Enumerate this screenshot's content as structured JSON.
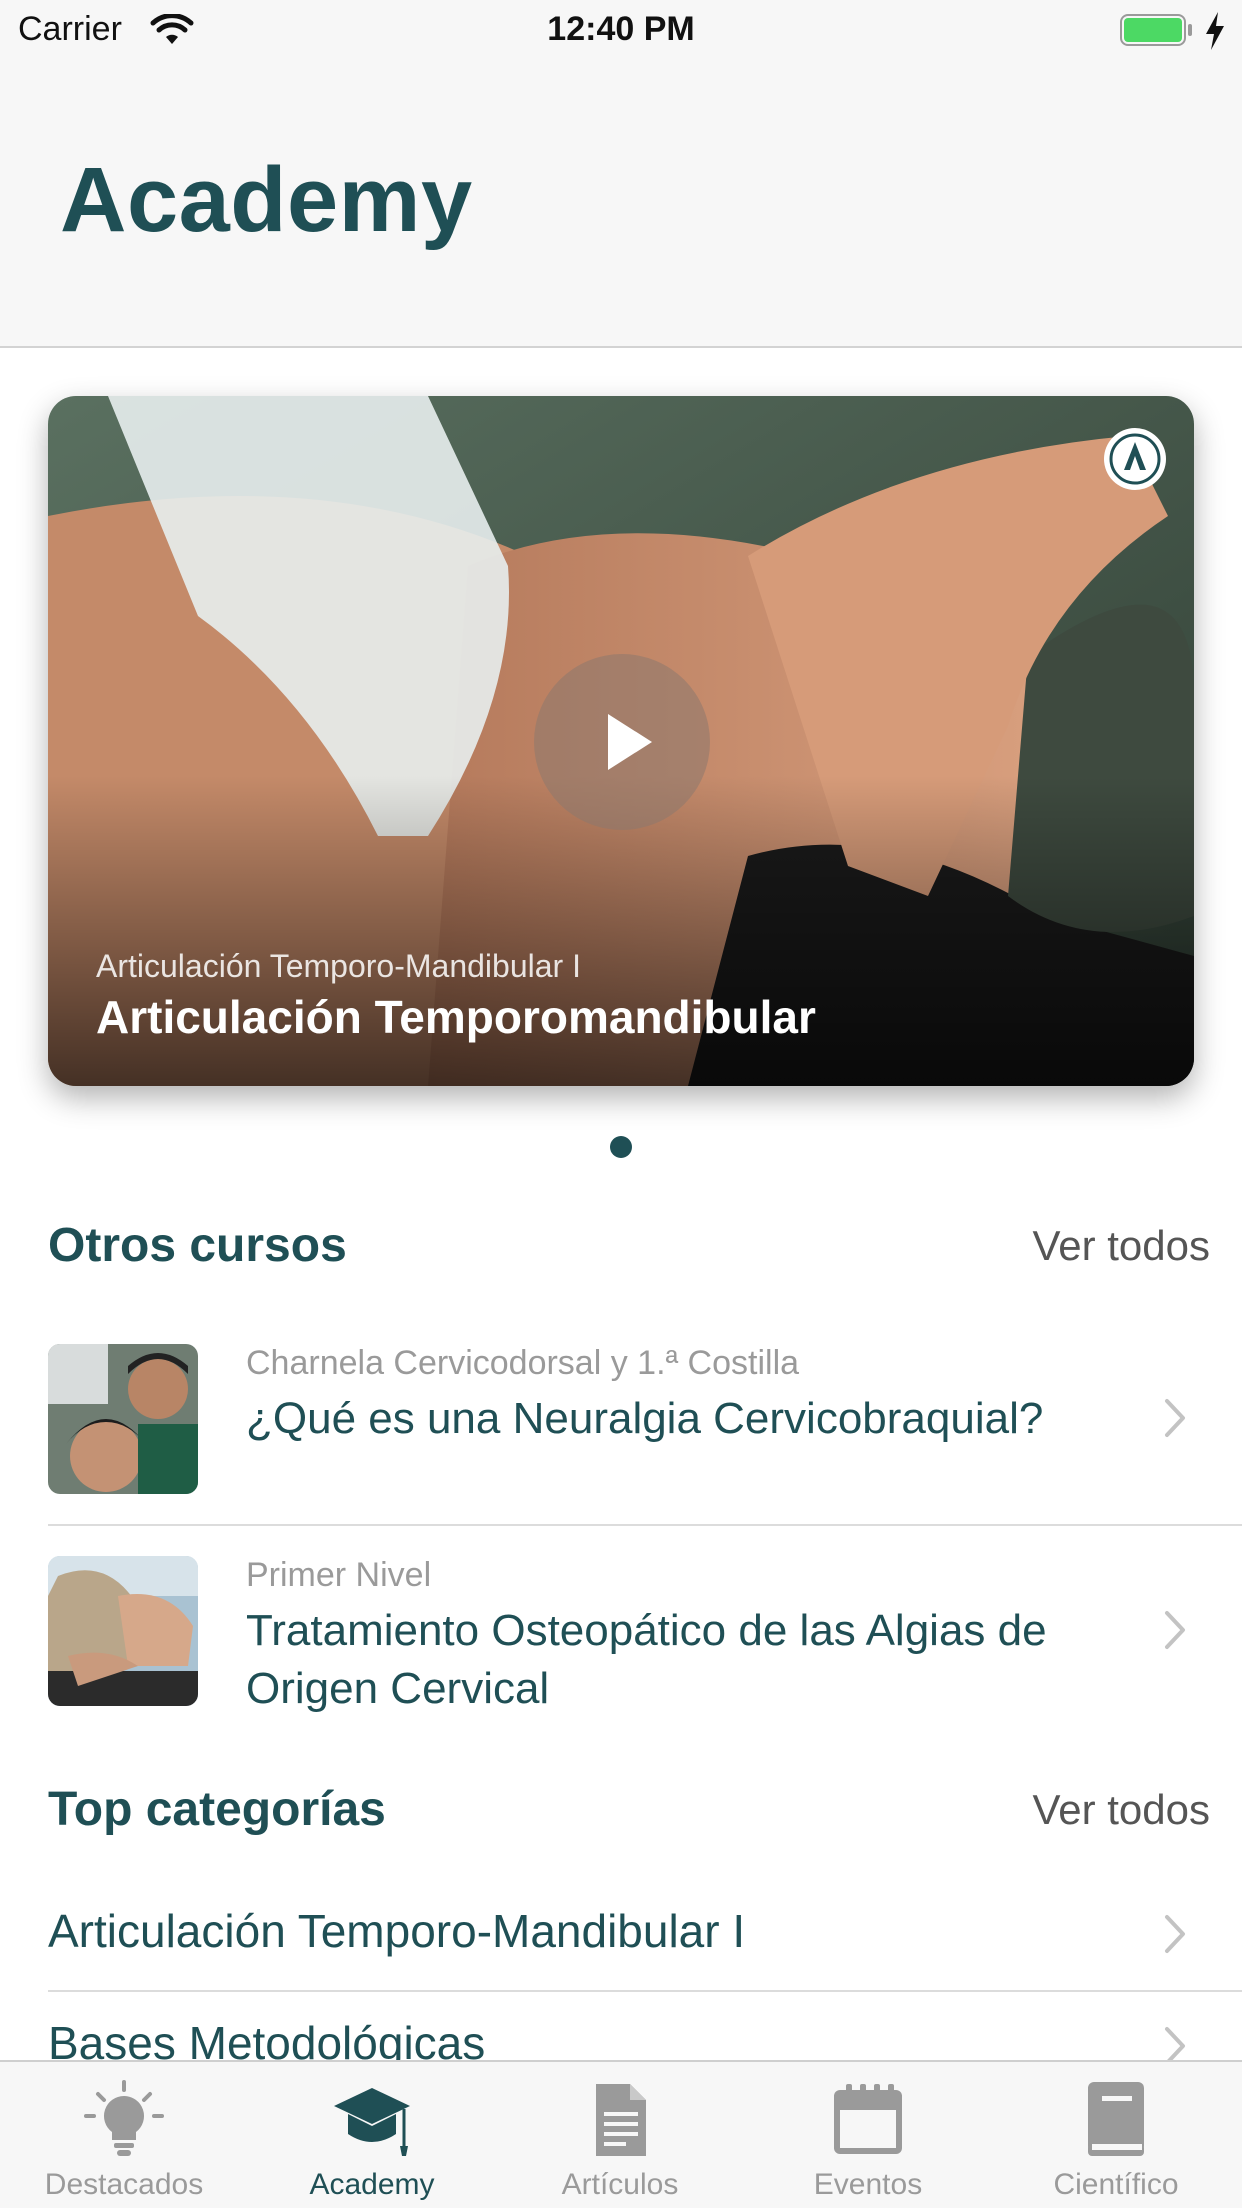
{
  "status_bar": {
    "carrier": "Carrier",
    "time": "12:40 PM",
    "battery_level": 1.0
  },
  "header": {
    "title": "Academy"
  },
  "featured": {
    "subtitle": "Articulación Temporo-Mandibular I",
    "title": "Articulación Temporomandibular",
    "icon": "play-icon",
    "page_count": 1,
    "current_page": 1
  },
  "otros_cursos": {
    "title": "Otros cursos",
    "see_all": "Ver todos",
    "items": [
      {
        "subtitle": "Charnela Cervicodorsal y 1.ª Costilla",
        "title": "¿Qué es una Neuralgia Cervicobraquial?"
      },
      {
        "subtitle": "Primer Nivel",
        "title": "Tratamiento Osteopático de las Algias de Origen Cervical"
      }
    ]
  },
  "top_categorias": {
    "title": "Top categorías",
    "see_all": "Ver todos",
    "items": [
      {
        "label": "Articulación Temporo-Mandibular I"
      },
      {
        "label": "Bases Metodológicas"
      }
    ]
  },
  "tab_bar": {
    "active_index": 1,
    "tabs": [
      {
        "label": "Destacados",
        "icon": "lightbulb-icon"
      },
      {
        "label": "Academy",
        "icon": "graduation-cap-icon"
      },
      {
        "label": "Artículos",
        "icon": "document-icon"
      },
      {
        "label": "Eventos",
        "icon": "calendar-icon"
      },
      {
        "label": "Científico",
        "icon": "book-icon"
      }
    ]
  },
  "colors": {
    "accent": "#1f4f55",
    "secondary_text": "#9a9a9a",
    "battery": "#4cd964"
  }
}
